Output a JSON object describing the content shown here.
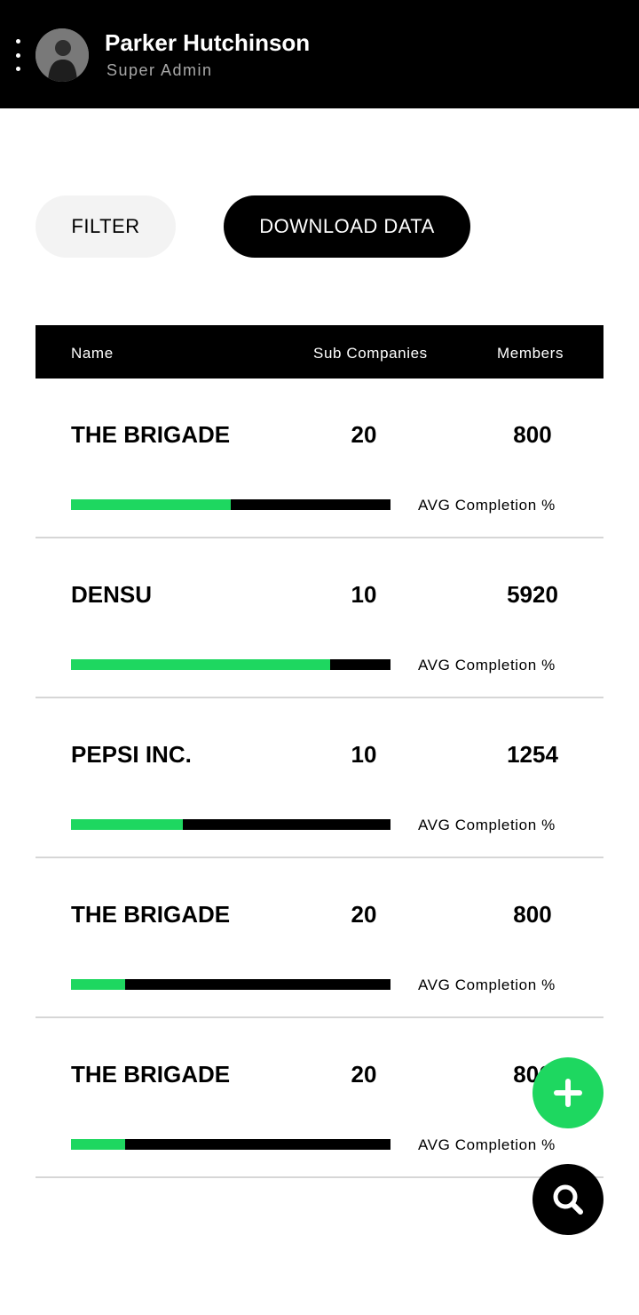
{
  "header": {
    "user_name": "Parker Hutchinson",
    "user_role": "Super Admin",
    "menu_icon": "more-vertical-icon",
    "avatar_icon": "user-avatar"
  },
  "actions": {
    "filter_label": "FILTER",
    "download_label": "DOWNLOAD DATA"
  },
  "table": {
    "columns": {
      "name": "Name",
      "sub_companies": "Sub Companies",
      "members": "Members"
    },
    "rows": [
      {
        "name": "THE BRIGADE",
        "sub_companies": "20",
        "members": "800",
        "completion": 0.5,
        "completion_label": "AVG Completion %"
      },
      {
        "name": "DENSU",
        "sub_companies": "10",
        "members": "5920",
        "completion": 0.81,
        "completion_label": "AVG Completion %"
      },
      {
        "name": "PEPSI INC.",
        "sub_companies": "10",
        "members": "1254",
        "completion": 0.35,
        "completion_label": "AVG Completion %"
      },
      {
        "name": "THE BRIGADE",
        "sub_companies": "20",
        "members": "800",
        "completion": 0.17,
        "completion_label": "AVG Completion %"
      },
      {
        "name": "THE BRIGADE",
        "sub_companies": "20",
        "members": "800",
        "completion": 0.17,
        "completion_label": "AVG Completion %"
      }
    ]
  },
  "fab": {
    "add_icon": "plus-icon",
    "search_icon": "search-icon"
  },
  "colors": {
    "accent": "#1ed760",
    "dark": "#000000",
    "light_button": "#f3f3f3",
    "divider": "#d6d6d6"
  }
}
